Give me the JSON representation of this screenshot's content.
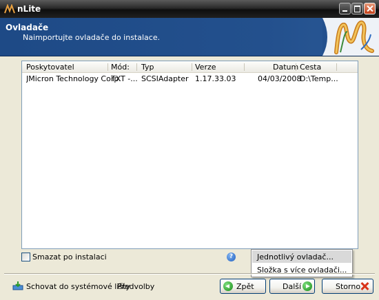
{
  "window": {
    "title": "nLite"
  },
  "header": {
    "title": "Ovladače",
    "subtitle": "Naimportujte ovladače do instalace."
  },
  "table": {
    "columns": [
      "Poskytovatel",
      "Mód:",
      "Typ",
      "Verze",
      "Datum",
      "Cesta"
    ],
    "rows": [
      [
        "JMicron Technology Corp.",
        "TXT -...",
        "SCSIAdapter",
        "1.17.33.03",
        "04/03/2008",
        "D:\\Temp..."
      ]
    ]
  },
  "options": {
    "delete_after_install": "Smazat po instalaci",
    "delete_after_install_checked": false
  },
  "add_menu": {
    "items": [
      "Jednotlivý ovladač...",
      "Složka s více ovladači..."
    ],
    "highlighted_index": 0
  },
  "footer": {
    "hide_to_tray": "Schovat do systémové lišty",
    "preferences": "Předvolby",
    "back": "Zpět",
    "next": "Další",
    "cancel": "Storno"
  }
}
